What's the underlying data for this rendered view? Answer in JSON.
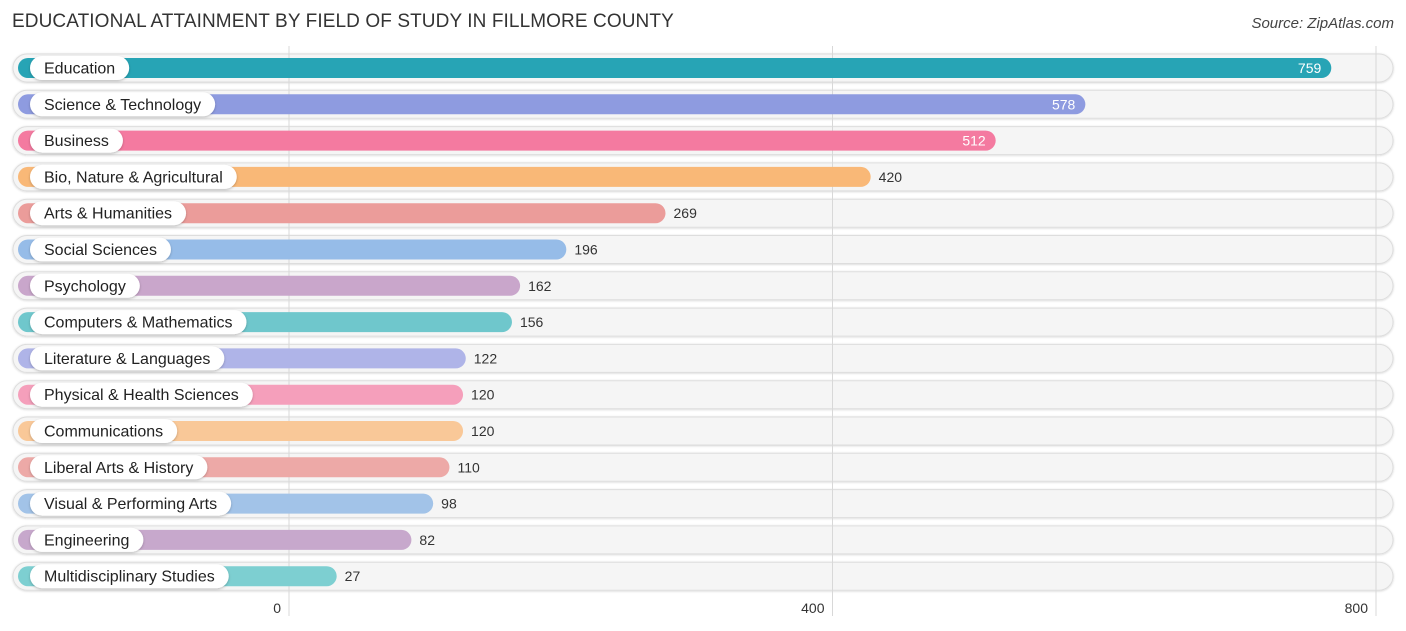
{
  "header": {
    "title": "EDUCATIONAL ATTAINMENT BY FIELD OF STUDY IN FILLMORE COUNTY",
    "source": "Source: ZipAtlas.com"
  },
  "chart_data": {
    "type": "bar",
    "orientation": "horizontal",
    "title": "EDUCATIONAL ATTAINMENT BY FIELD OF STUDY IN FILLMORE COUNTY",
    "xlabel": "",
    "ylabel": "",
    "xlim": [
      0,
      800
    ],
    "x_ticks": [
      0,
      400,
      800
    ],
    "x_tick_labels": [
      "0",
      "400",
      "800"
    ],
    "grid": true,
    "categories": [
      "Education",
      "Science & Technology",
      "Business",
      "Bio, Nature & Agricultural",
      "Arts & Humanities",
      "Social Sciences",
      "Psychology",
      "Computers & Mathematics",
      "Literature & Languages",
      "Physical & Health Sciences",
      "Communications",
      "Liberal Arts & History",
      "Visual & Performing Arts",
      "Engineering",
      "Multidisciplinary Studies"
    ],
    "values": [
      759,
      578,
      512,
      420,
      269,
      196,
      162,
      156,
      122,
      120,
      120,
      110,
      98,
      82,
      27
    ],
    "value_labels": [
      "759",
      "578",
      "512",
      "420",
      "269",
      "196",
      "162",
      "156",
      "122",
      "120",
      "120",
      "110",
      "98",
      "82",
      "27"
    ],
    "colors": [
      "#27a4b5",
      "#8e9be0",
      "#f47aa0",
      "#f9b877",
      "#eb9c9a",
      "#96bce8",
      "#c9a6cb",
      "#6fc7cc",
      "#afb4e8",
      "#f59fbb",
      "#f9c898",
      "#eda9a7",
      "#a2c3e8",
      "#c7a8cc",
      "#7dcfd1"
    ],
    "value_label_inside_threshold": 500
  }
}
